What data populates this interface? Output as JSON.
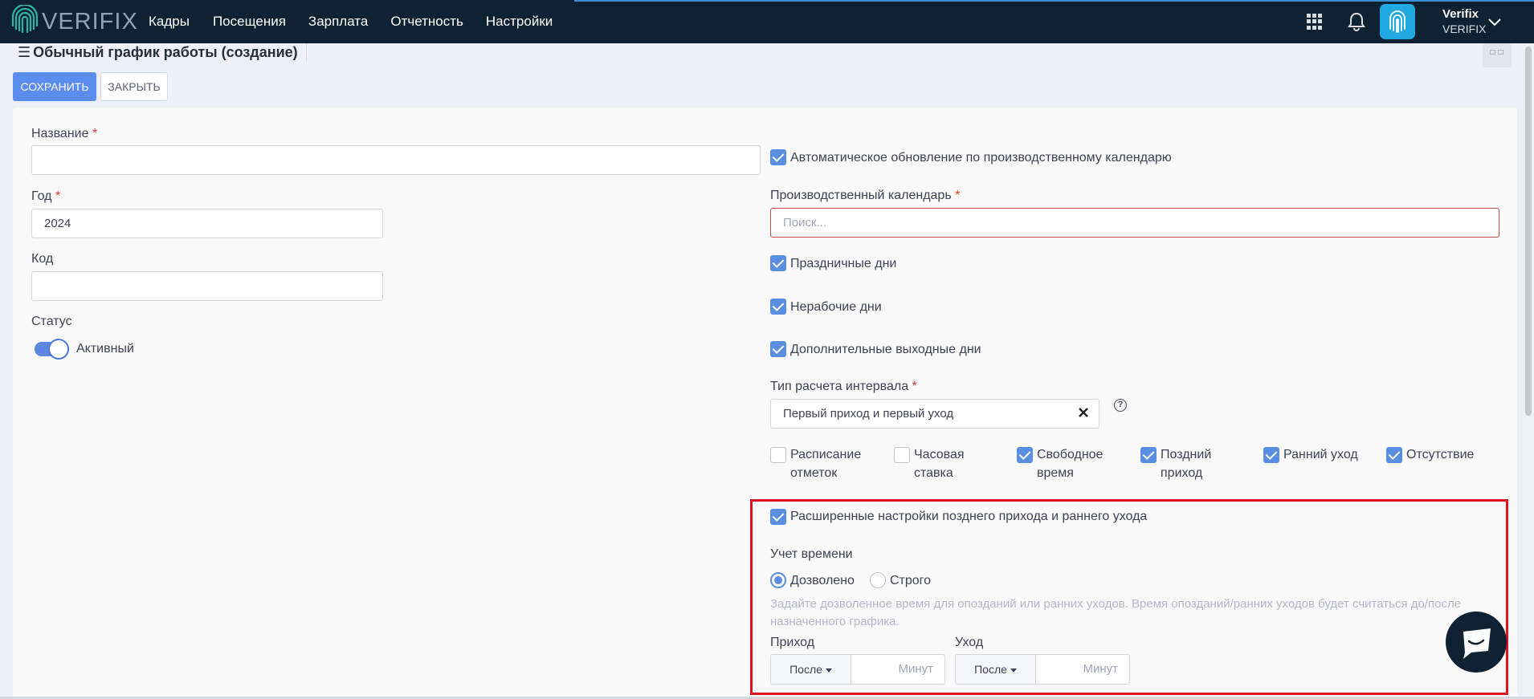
{
  "app": {
    "logo_text": "VERIFIX",
    "nav": [
      "Кадры",
      "Посещения",
      "Зарплата",
      "Отчетность",
      "Настройки"
    ],
    "user": {
      "name": "Verifix",
      "company": "VERIFIX"
    },
    "colors": {
      "topbar": "#0e2233",
      "primary": "#5a8dee",
      "required": "#e0393e",
      "highlight": "#e0141c"
    }
  },
  "page": {
    "title": "Обычный график работы (создание)",
    "save_label": "СОХРАНИТЬ",
    "close_label": "ЗАКРЫТЬ"
  },
  "form": {
    "name": {
      "label": "Название",
      "required": "*",
      "value": ""
    },
    "year": {
      "label": "Год",
      "required": "*",
      "value": "2024"
    },
    "code": {
      "label": "Код",
      "value": ""
    },
    "status": {
      "label": "Статус",
      "value": "Активный",
      "on": true
    },
    "auto_update": {
      "label": "Автоматическое обновление по производственному календарю",
      "checked": true
    },
    "calendar": {
      "label": "Производственный календарь",
      "required": "*",
      "placeholder": "Поиск..."
    },
    "holidays": {
      "label": "Праздничные дни",
      "checked": true
    },
    "nonworking": {
      "label": "Нерабочие дни",
      "checked": true
    },
    "extra_days_off": {
      "label": "Дополнительные выходные дни",
      "checked": true
    },
    "interval_type": {
      "label": "Тип расчета интервала",
      "required": "*",
      "value": "Первый приход и первый уход"
    },
    "options": [
      {
        "line1": "Расписание",
        "line2": "отметок",
        "checked": false
      },
      {
        "line1": "Часовая",
        "line2": "ставка",
        "checked": false
      },
      {
        "line1": "Свободное",
        "line2": "время",
        "checked": true
      },
      {
        "line1": "Поздний",
        "line2": "приход",
        "checked": true
      },
      {
        "line1": "Ранний уход",
        "line2": "",
        "checked": true
      },
      {
        "line1": "Отсутствие",
        "line2": "",
        "checked": true
      }
    ],
    "extended": {
      "label": "Расширенные настройки позднего прихода и раннего ухода",
      "checked": true,
      "time_accounting_label": "Учет времени",
      "radio_allowed": "Дозволено",
      "radio_strict": "Строго",
      "selected": "Дозволено",
      "hint": "Задайте дозволенное время для опозданий или ранних уходов. Время опозданий/ранних уходов будет считаться до/после назначенного графика.",
      "arrival": {
        "label": "Приход",
        "mode": "После",
        "unit": "Минут"
      },
      "departure": {
        "label": "Уход",
        "mode": "После",
        "unit": "Минут"
      }
    }
  },
  "icons": [
    "fingerprint-logo",
    "apps-grid-icon",
    "bell-icon",
    "fingerprint-icon",
    "chevron-down-icon",
    "clear-icon",
    "help-icon",
    "chat-icon",
    "menu-icon"
  ]
}
